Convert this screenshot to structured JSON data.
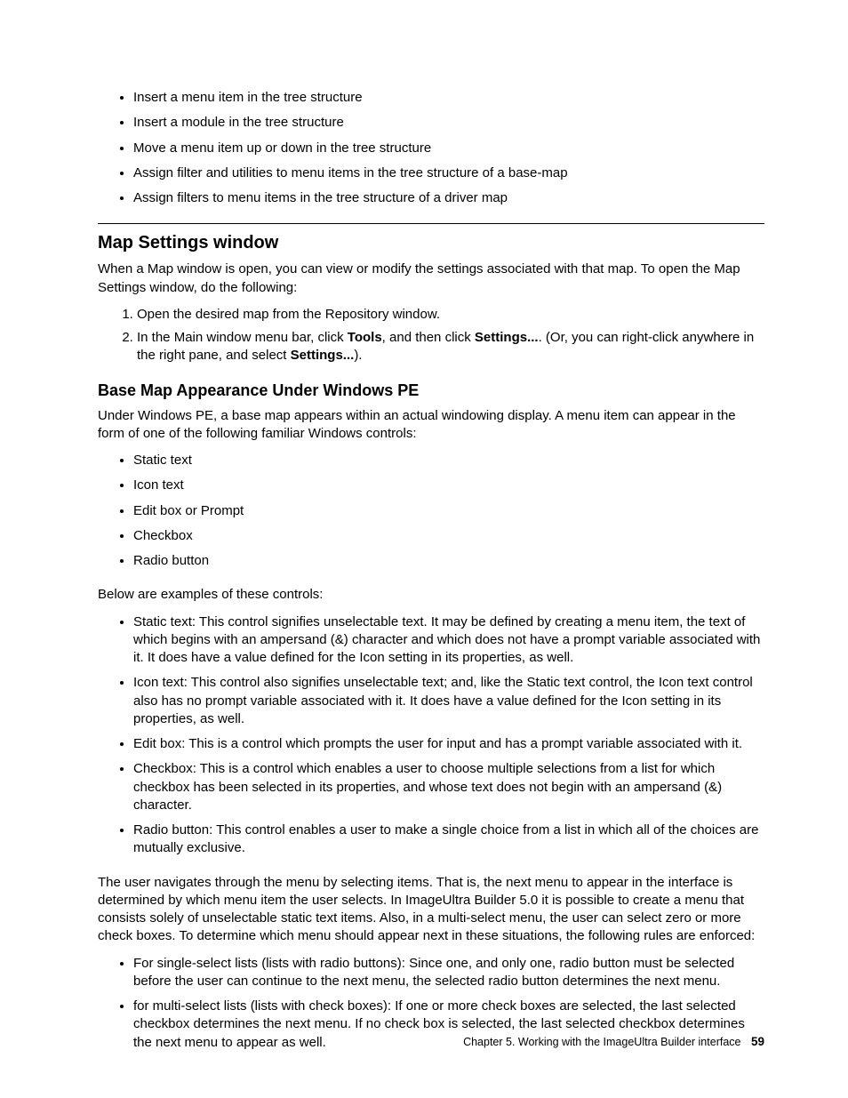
{
  "top_bullets": [
    "Insert a menu item in the tree structure",
    "Insert a module in the tree structure",
    "Move a menu item up or down in the tree structure",
    "Assign filter and utilities to menu items in the tree structure of a base-map",
    "Assign filters to menu items in the tree structure of a driver map"
  ],
  "map_settings": {
    "heading": "Map Settings window",
    "intro": "When a Map window is open, you can view or modify the settings associated with that map. To open the Map Settings window, do the following:",
    "step1": "Open the desired map from the Repository window.",
    "step2_prefix": "In the Main window menu bar, click ",
    "step2_tools": "Tools",
    "step2_mid": ", and then click ",
    "step2_settings1": "Settings...",
    "step2_mid2": ". (Or, you can right-click anywhere in the right pane, and select ",
    "step2_settings2": "Settings...",
    "step2_end": ")."
  },
  "base_map": {
    "heading": "Base Map Appearance Under Windows PE",
    "intro": "Under Windows PE, a base map appears within an actual windowing display. A menu item can appear in the form of one of the following familiar Windows controls:",
    "controls": [
      "Static text",
      "Icon text",
      "Edit box or Prompt",
      "Checkbox",
      "Radio button"
    ],
    "examples_intro": "Below are examples of these controls:",
    "examples": [
      "Static text: This control signifies unselectable text. It may be defined by creating a menu item, the text of which begins with an ampersand (&) character and which does not have a prompt variable associated with it. It does have a value defined for the Icon setting in its properties, as well.",
      "Icon text: This control also signifies unselectable text; and, like the Static text control, the Icon text control also has no prompt variable associated with it. It does have a value defined for the Icon setting in its properties, as well.",
      "Edit box: This is a control which prompts the user for input and has a prompt variable associated with it.",
      "Checkbox: This is a control which enables a user to choose multiple selections from a list for which checkbox has been selected in its properties, and whose text does not begin with an ampersand (&) character.",
      "Radio button: This control enables a user to make a single choice from a list in which all of the choices are mutually exclusive."
    ],
    "nav_para": "The user navigates through the menu by selecting items. That is, the next menu to appear in the interface is determined by which menu item the user selects. In ImageUltra Builder 5.0 it is possible to create a menu that consists solely of unselectable static text items. Also, in a multi-select menu, the user can select zero or more check boxes. To determine which menu should appear next in these situations, the following rules are enforced:",
    "rules": [
      "For single-select lists (lists with radio buttons): Since one, and only one, radio button must be selected before the user can continue to the next menu, the selected radio button determines the next menu.",
      "for multi-select lists (lists with check boxes): If one or more check boxes are selected, the last selected checkbox determines the next menu. If no check box is selected, the last selected checkbox determines the next menu to appear as well."
    ]
  },
  "footer": {
    "chapter": "Chapter 5. Working with the ImageUltra Builder interface",
    "page": "59"
  }
}
